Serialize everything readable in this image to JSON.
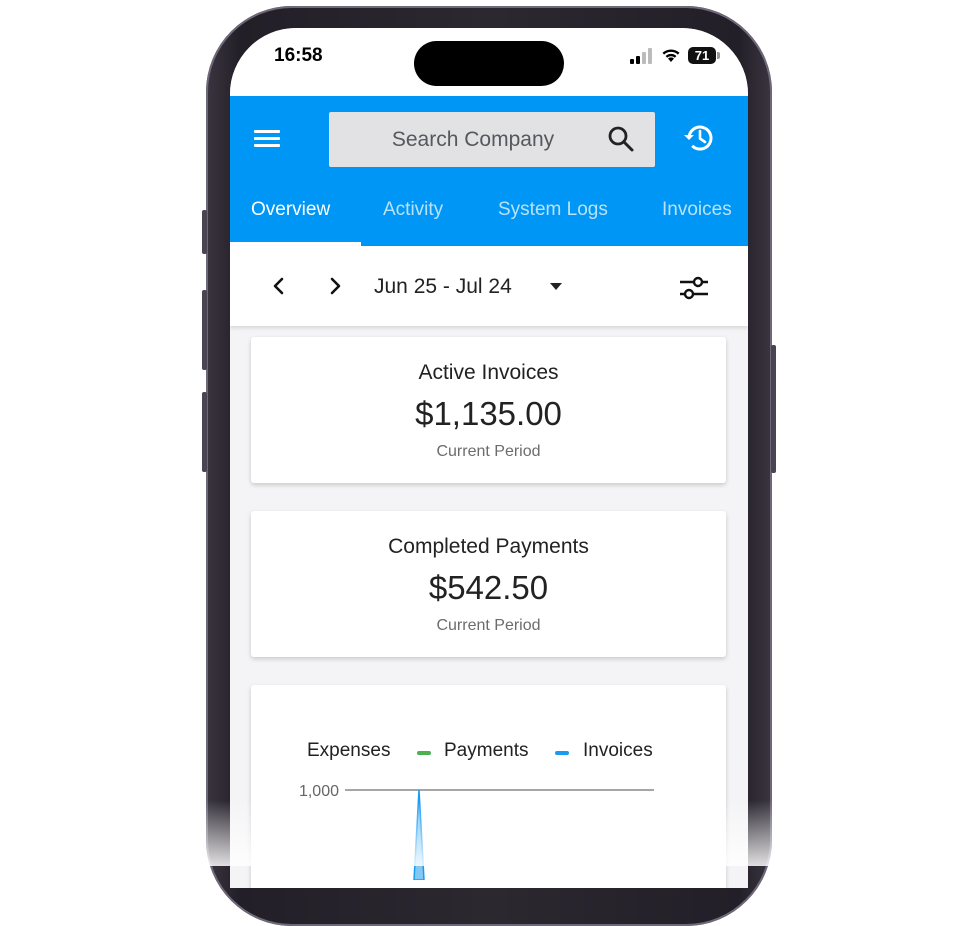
{
  "status_bar": {
    "time": "16:58",
    "battery": "71"
  },
  "header": {
    "search": {
      "placeholder": "Search Company"
    },
    "tabs": [
      {
        "label": "Overview",
        "active": true
      },
      {
        "label": "Activity"
      },
      {
        "label": "System Logs"
      },
      {
        "label": "Invoices"
      }
    ]
  },
  "date_bar": {
    "range": "Jun 25 - Jul 24"
  },
  "cards": [
    {
      "title": "Active Invoices",
      "value": "$1,135.00",
      "subtitle": "Current Period"
    },
    {
      "title": "Completed Payments",
      "value": "$542.50",
      "subtitle": "Current Period"
    }
  ],
  "chart_data": {
    "type": "line",
    "series": [
      {
        "name": "Expenses",
        "values": []
      },
      {
        "name": "Payments",
        "color": "#4caf50",
        "values": []
      },
      {
        "name": "Invoices",
        "color": "#1a9bf0",
        "values": [
          0,
          1000,
          0
        ]
      }
    ],
    "ylabels": [
      "1,000"
    ],
    "colors": {
      "payments": "#4caf50",
      "invoices": "#1a9bf0"
    }
  },
  "theme": {
    "accent": "#0096f5"
  }
}
